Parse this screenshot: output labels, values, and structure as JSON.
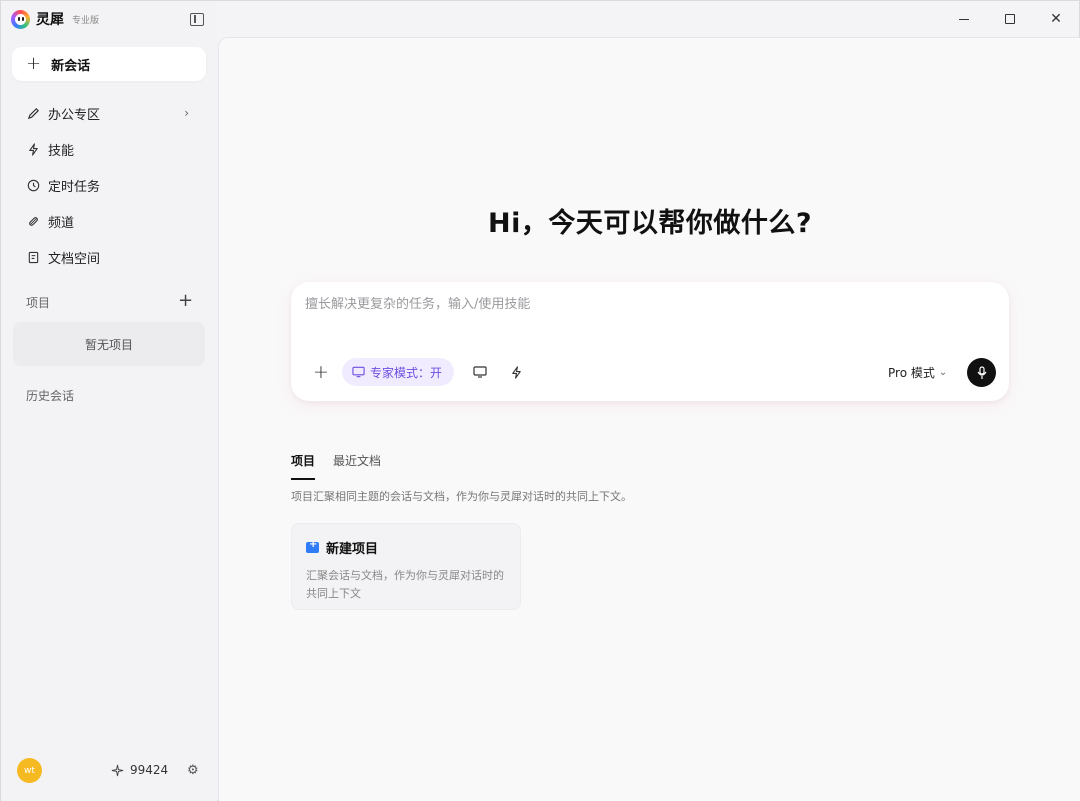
{
  "app": {
    "name": "灵犀",
    "edition": "专业版"
  },
  "sidebar": {
    "new_chat": "新会话",
    "items": [
      {
        "label": "办公专区",
        "icon": "pen-icon",
        "has_chevron": true
      },
      {
        "label": "技能",
        "icon": "lightning-icon"
      },
      {
        "label": "定时任务",
        "icon": "clock-icon"
      },
      {
        "label": "频道",
        "icon": "channel-icon"
      },
      {
        "label": "文档空间",
        "icon": "document-icon"
      }
    ],
    "projects_label": "项目",
    "projects_empty": "暂无项目",
    "history_label": "历史会话",
    "user_avatar": "wt",
    "credits": "99424"
  },
  "main": {
    "hero": "Hi，今天可以帮你做什么?",
    "composer": {
      "placeholder": "擅长解决更复杂的任务，输入/使用技能",
      "expert_mode": "专家模式：开",
      "pro_mode": "Pro 模式"
    },
    "tabs": [
      {
        "label": "项目",
        "active": true
      },
      {
        "label": "最近文档",
        "active": false
      }
    ],
    "tab_description": "项目汇聚相同主题的会话与文档，作为你与灵犀对话时的共同上下文。",
    "card": {
      "title": "新建项目",
      "description": "汇聚会话与文档，作为你与灵犀对话时的共同上下文"
    }
  },
  "colors": {
    "accent": "#6d4ee0",
    "expert_bg": "#f1ebff",
    "avatar": "#f5b922",
    "folder": "#2f7cf6"
  }
}
